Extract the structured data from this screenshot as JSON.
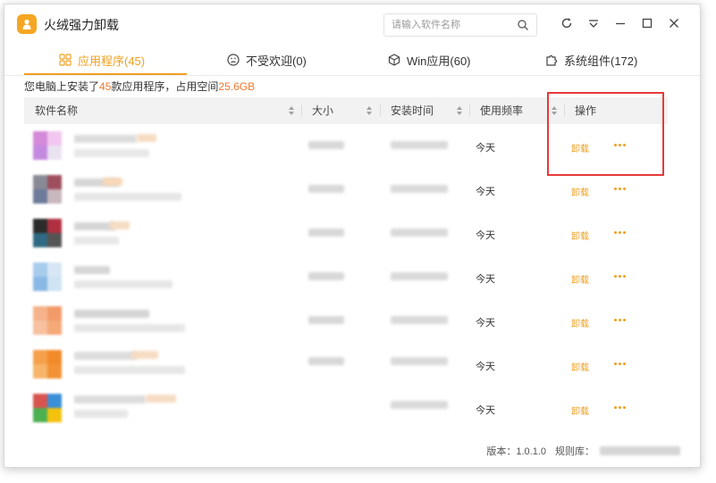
{
  "app": {
    "title": "火绒强力卸载",
    "logo_icon": "person-bag-icon",
    "accent": "#f0a020"
  },
  "search": {
    "placeholder": "请输入软件名称",
    "value": ""
  },
  "window_controls": [
    "refresh-icon",
    "dropdown-menu-icon",
    "minimize-icon",
    "maximize-icon",
    "close-icon"
  ],
  "tabs": [
    {
      "label": "应用程序(45)",
      "icon": "grid-icon",
      "active": true
    },
    {
      "label": "不受欢迎(0)",
      "icon": "frown-face-icon",
      "active": false
    },
    {
      "label": "Win应用(60)",
      "icon": "cube-icon",
      "active": false
    },
    {
      "label": "系统组件(172)",
      "icon": "puzzle-icon",
      "active": false
    }
  ],
  "summary": {
    "prefix": "您电脑上安装了",
    "count": "45",
    "middle": "款应用程序，占用空间",
    "size": "25.6GB"
  },
  "table": {
    "columns": [
      "软件名称",
      "大小",
      "安装时间",
      "使用频率",
      "操作"
    ],
    "rows": [
      {
        "frequency": "今天",
        "action": "卸载",
        "icon_colors": [
          "#d48ad8",
          "#f2c6f0",
          "#c48ae0",
          "#e9e3f0"
        ]
      },
      {
        "frequency": "今天",
        "action": "卸载",
        "icon_colors": [
          "#8a8a96",
          "#9f4e5e",
          "#6e7a9a",
          "#c9b7be"
        ]
      },
      {
        "frequency": "今天",
        "action": "卸载",
        "icon_colors": [
          "#2b2b2b",
          "#b03040",
          "#2f6a82",
          "#555555"
        ]
      },
      {
        "frequency": "今天",
        "action": "卸载",
        "icon_colors": [
          "#a8ccec",
          "#d6e6f4",
          "#8ab8e4",
          "#cfe3f2"
        ]
      },
      {
        "frequency": "今天",
        "action": "卸载",
        "icon_colors": [
          "#f6b28a",
          "#f39a6a",
          "#f7c19f",
          "#f5a878"
        ]
      },
      {
        "frequency": "今天",
        "action": "卸载",
        "icon_colors": [
          "#f5a04a",
          "#f28a2a",
          "#f7b56a",
          "#f39234"
        ]
      },
      {
        "frequency": "今天",
        "action": "卸载",
        "icon_colors": [
          "#d9534f",
          "#3a8fd6",
          "#4caf50",
          "#f4c20d"
        ]
      }
    ]
  },
  "footer": {
    "version": "版本：1.0.1.0",
    "library": "规则库："
  }
}
